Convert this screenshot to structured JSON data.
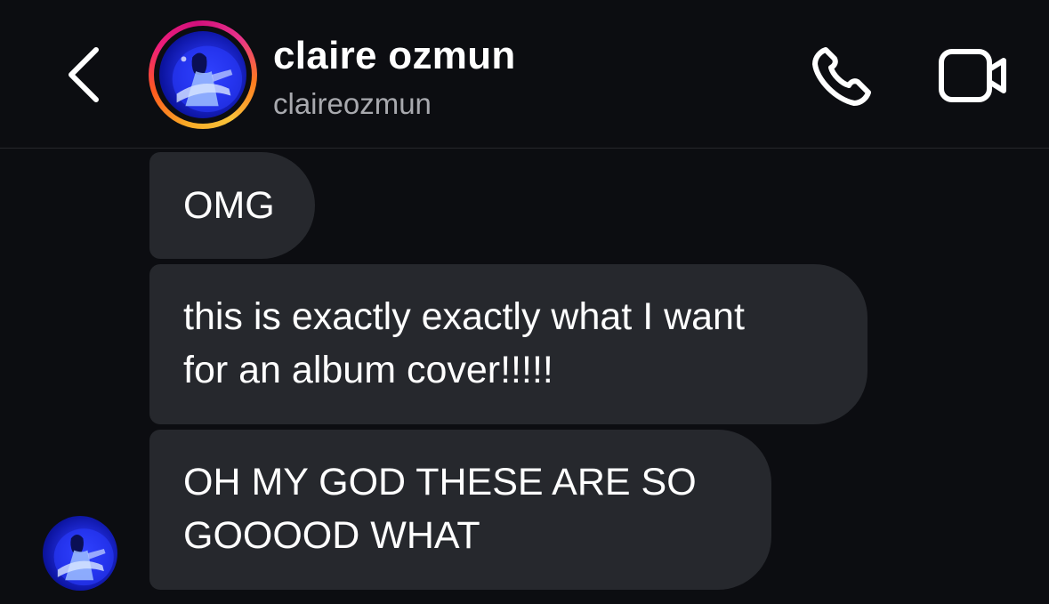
{
  "header": {
    "back_icon": "chevron-left-icon",
    "display_name": "claire ozmun",
    "username": "claireozmun",
    "call_icon": "phone-icon",
    "video_icon": "video-camera-icon",
    "story_ring_colors": [
      "#f9a825",
      "#ff5a1f",
      "#ee1d7a",
      "#d1107c"
    ]
  },
  "messages": [
    {
      "lines": [
        "OMG"
      ]
    },
    {
      "lines": [
        "this is exactly exactly what I want",
        "for an album cover!!!!!"
      ]
    },
    {
      "lines": [
        "OH MY GOD THESE ARE SO",
        "GOOOOD WHAT"
      ]
    }
  ],
  "colors": {
    "background": "#0c0d11",
    "bubble": "#26282d",
    "username": "#a8a9ae"
  }
}
